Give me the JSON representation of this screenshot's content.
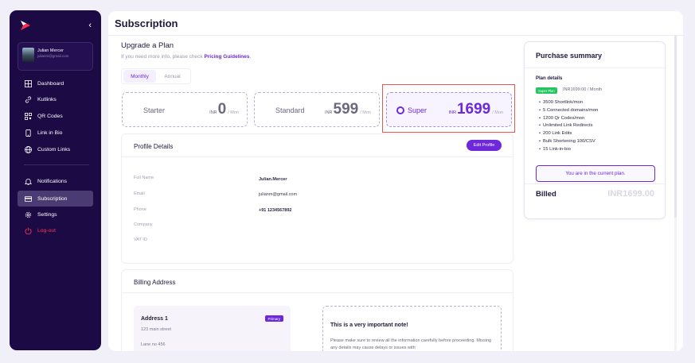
{
  "sidebar": {
    "user": {
      "name": "Julian Mercer",
      "email": "julianm@gmail.com"
    },
    "nav": [
      {
        "label": "Dashboard",
        "icon": "grid-icon"
      },
      {
        "label": "Kutlinks",
        "icon": "link-icon"
      },
      {
        "label": "QR Codes",
        "icon": "qr-code-icon"
      },
      {
        "label": "Link in Bio",
        "icon": "phone-icon"
      },
      {
        "label": "Custom Links",
        "icon": "globe-icon"
      }
    ],
    "secondary": [
      {
        "label": "Notifications",
        "icon": "bell-icon"
      },
      {
        "label": "Subscription",
        "icon": "card-icon",
        "active": true
      },
      {
        "label": "Settings",
        "icon": "gear-icon"
      },
      {
        "label": "Log-out",
        "icon": "power-icon"
      }
    ]
  },
  "page": {
    "title": "Subscription"
  },
  "upgrade": {
    "title": "Upgrade a Plan",
    "subtitle": "If you need more info, please check",
    "link": "Pricing Guidelines",
    "link_suffix": ".",
    "tabs": [
      "Monthly",
      "Annual"
    ],
    "active_tab": "Monthly"
  },
  "plans": [
    {
      "name": "Starter",
      "currency": "INR",
      "amount": "0",
      "period": "/ Mon"
    },
    {
      "name": "Standard",
      "currency": "INR",
      "amount": "599",
      "period": "/ Mon"
    },
    {
      "name": "Super",
      "currency": "INR",
      "amount": "1699",
      "period": "/ Mon",
      "selected": true
    }
  ],
  "profile": {
    "title": "Profile Details",
    "edit_label": "Edit Profile",
    "fields": [
      {
        "label": "Full Name",
        "value": "Julian.Mercer"
      },
      {
        "label": "Email",
        "value": "julianm@gmail.com"
      },
      {
        "label": "Phone",
        "value": "+91 1234567892"
      },
      {
        "label": "Company",
        "value": ""
      },
      {
        "label": "VAT ID",
        "value": ""
      }
    ]
  },
  "billing": {
    "title": "Billing Address",
    "address": {
      "title": "Address 1",
      "badge": "Primary",
      "line1": "123 main street",
      "line2": "Lane no 456"
    },
    "note": {
      "title": "This is a very important note!",
      "body": "Please make sure to review all the information carefully before proceeding. Missing any details may cause delays or issues with"
    }
  },
  "summary": {
    "title": "Purchase summary",
    "plan_details_label": "Plan details",
    "badge": "Super Plan",
    "price_text": "INR1699.00 / Month",
    "features": [
      "3500 Shortlink/mon",
      "5 Connected domains/mon",
      "1200 Qr Codes/mon",
      "Unlimited Link Redirects",
      "200 Link Edits",
      "Bulk Shortening 100/CSV",
      "15 Link-in-bio"
    ],
    "current_plan_label": "You are in the current plan.",
    "billed_label": "Billed",
    "billed_amount": "INR1699.00"
  },
  "colors": {
    "accent": "#6d28d9",
    "sidebar": "#1c0a45",
    "logout": "#ff2d55",
    "badge_green": "#22c55e",
    "highlight": "#e8574f"
  }
}
